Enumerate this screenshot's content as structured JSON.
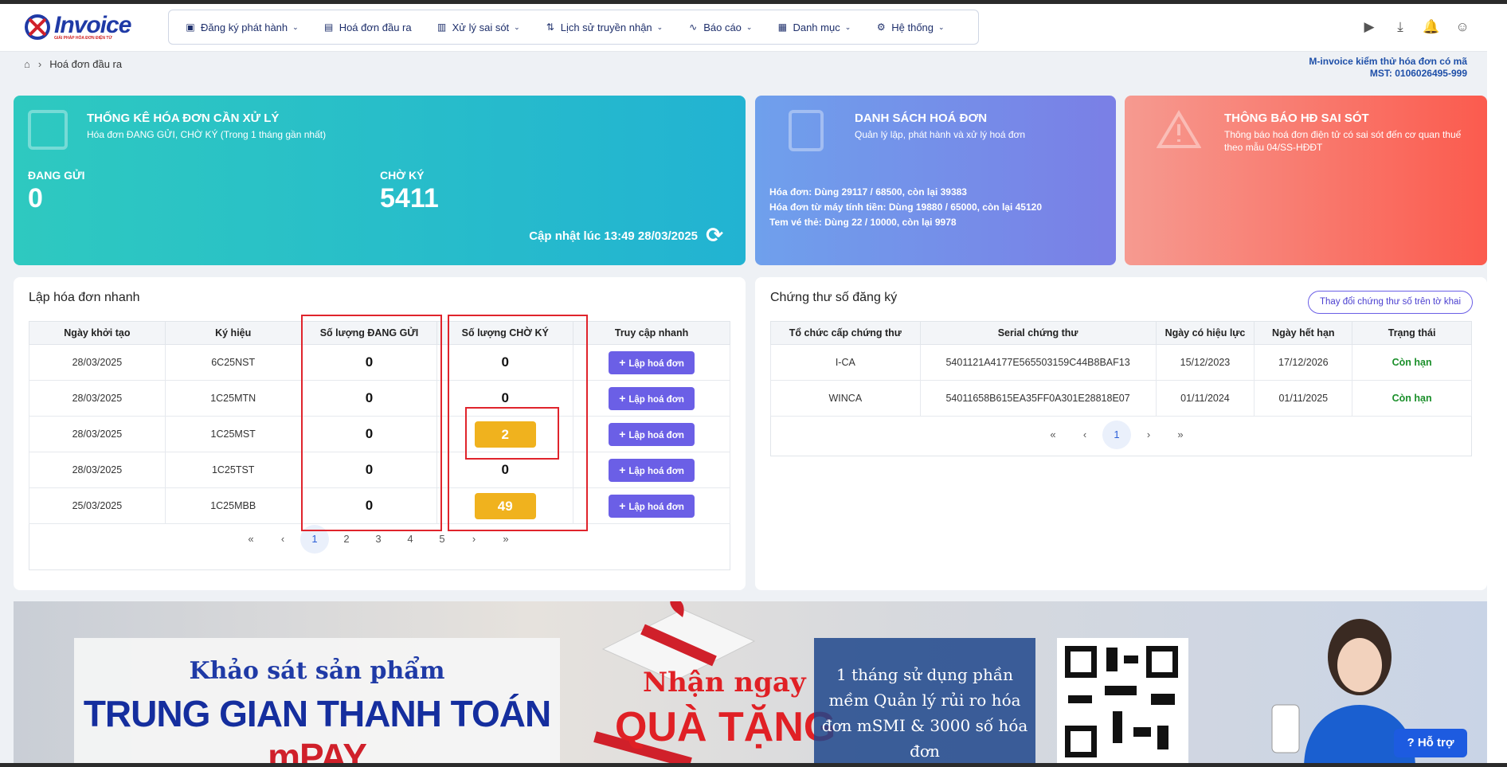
{
  "app": {
    "logo_text": "Invoice",
    "logo_sub": "GIẢI PHÁP HÓA ĐƠN ĐIỆN TỬ"
  },
  "nav": [
    {
      "label": "Đăng ký phát hành",
      "icon": "register-doc-icon",
      "glyph": "▣",
      "dropdown": true
    },
    {
      "label": "Hoá đơn đầu ra",
      "icon": "invoice-out-icon",
      "glyph": "▤",
      "dropdown": false
    },
    {
      "label": "Xử lý sai sót",
      "icon": "fix-error-icon",
      "glyph": "▥",
      "dropdown": true
    },
    {
      "label": "Lịch sử truyền nhận",
      "icon": "sort-arrows-icon",
      "glyph": "⇅",
      "dropdown": true
    },
    {
      "label": "Báo cáo",
      "icon": "chart-line-icon",
      "glyph": "∿",
      "dropdown": true
    },
    {
      "label": "Danh mục",
      "icon": "grid-icon",
      "glyph": "▦",
      "dropdown": true
    },
    {
      "label": "Hệ thống",
      "icon": "gear-icon",
      "glyph": "⚙",
      "dropdown": true
    }
  ],
  "breadcrumb": {
    "current": "Hoá đơn đầu ra"
  },
  "company": {
    "name": "M-invoice kiểm thử hóa đơn có mã",
    "mst": "MST: 0106026495-999"
  },
  "stats": {
    "title": "THỐNG KÊ HÓA ĐƠN CẦN XỬ LÝ",
    "subtitle": "Hóa đơn ĐANG GỬI, CHỜ KÝ (Trong 1 tháng gần nhất)",
    "sending_label": "ĐANG GỬI",
    "sending_value": "0",
    "pending_label": "CHỜ KÝ",
    "pending_value": "5411",
    "updated": "Cập nhật lúc 13:49 28/03/2025"
  },
  "invoice_list": {
    "title": "DANH SÁCH HOÁ ĐƠN",
    "subtitle": "Quản lý lập, phát hành và xử lý hoá đơn",
    "line1": "Hóa đơn: Dùng 29117 / 68500, còn lại 39383",
    "line2": "Hóa đơn từ máy tính tiền: Dùng 19880 / 65000, còn lại 45120",
    "line3": "Tem vé thẻ: Dùng 22 / 10000, còn lại 9978"
  },
  "error_notice": {
    "title": "THÔNG BÁO HĐ SAI SÓT",
    "subtitle": "Thông báo hoá đơn điện tử có sai sót đến cơ quan thuế theo mẫu 04/SS-HĐĐT"
  },
  "quick": {
    "title": "Lập hóa đơn nhanh",
    "headers": [
      "Ngày khởi tạo",
      "Ký hiệu",
      "Số lượng ĐANG GỬI",
      "Số lượng CHỜ KÝ",
      "Truy cập nhanh"
    ],
    "button_label": "Lập hoá đơn",
    "rows": [
      {
        "date": "28/03/2025",
        "symbol": "6C25NST",
        "sending": "0",
        "pending": "0",
        "pending_badge": false
      },
      {
        "date": "28/03/2025",
        "symbol": "1C25MTN",
        "sending": "0",
        "pending": "0",
        "pending_badge": false
      },
      {
        "date": "28/03/2025",
        "symbol": "1C25MST",
        "sending": "0",
        "pending": "2",
        "pending_badge": true
      },
      {
        "date": "28/03/2025",
        "symbol": "1C25TST",
        "sending": "0",
        "pending": "0",
        "pending_badge": false
      },
      {
        "date": "25/03/2025",
        "symbol": "1C25MBB",
        "sending": "0",
        "pending": "49",
        "pending_badge": true
      }
    ],
    "pager": [
      "«",
      "‹",
      "1",
      "2",
      "3",
      "4",
      "5",
      "›",
      "»"
    ],
    "active_page": "1"
  },
  "certs": {
    "title": "Chứng thư số đăng ký",
    "change_button": "Thay đổi chứng thư số trên tờ khai",
    "headers": [
      "Tổ chức cấp chứng thư",
      "Serial chứng thư",
      "Ngày có hiệu lực",
      "Ngày hết hạn",
      "Trạng thái"
    ],
    "rows": [
      {
        "org": "I-CA",
        "serial": "5401121A4177E565503159C44B8BAF13",
        "from": "15/12/2023",
        "to": "17/12/2026",
        "status": "Còn hạn"
      },
      {
        "org": "WINCA",
        "serial": "54011658B615EA35FF0A301E28818E07",
        "from": "01/11/2024",
        "to": "01/11/2025",
        "status": "Còn hạn"
      }
    ],
    "pager": [
      "«",
      "‹",
      "1",
      "›",
      "»"
    ],
    "active_page": "1"
  },
  "banner": {
    "line1": "Khảo sát sản phẩm",
    "line2a": "TRUNG GIAN THANH TOÁN ",
    "line2b": "mPAY",
    "gift1": "Nhận ngay",
    "gift2": "QUÀ TẶNG",
    "offer": "1 tháng sử dụng phần mềm Quản lý rủi ro hóa đơn mSMI & 3000 số hóa đơn"
  },
  "help": {
    "label": "Hỗ trợ"
  },
  "colors": {
    "teal": "#22b3d2",
    "purple": "#7a7fe6",
    "red": "#fb5b4e",
    "badge": "#f0b21e",
    "button": "#6b5fe6",
    "ok": "#1a8f2a"
  }
}
